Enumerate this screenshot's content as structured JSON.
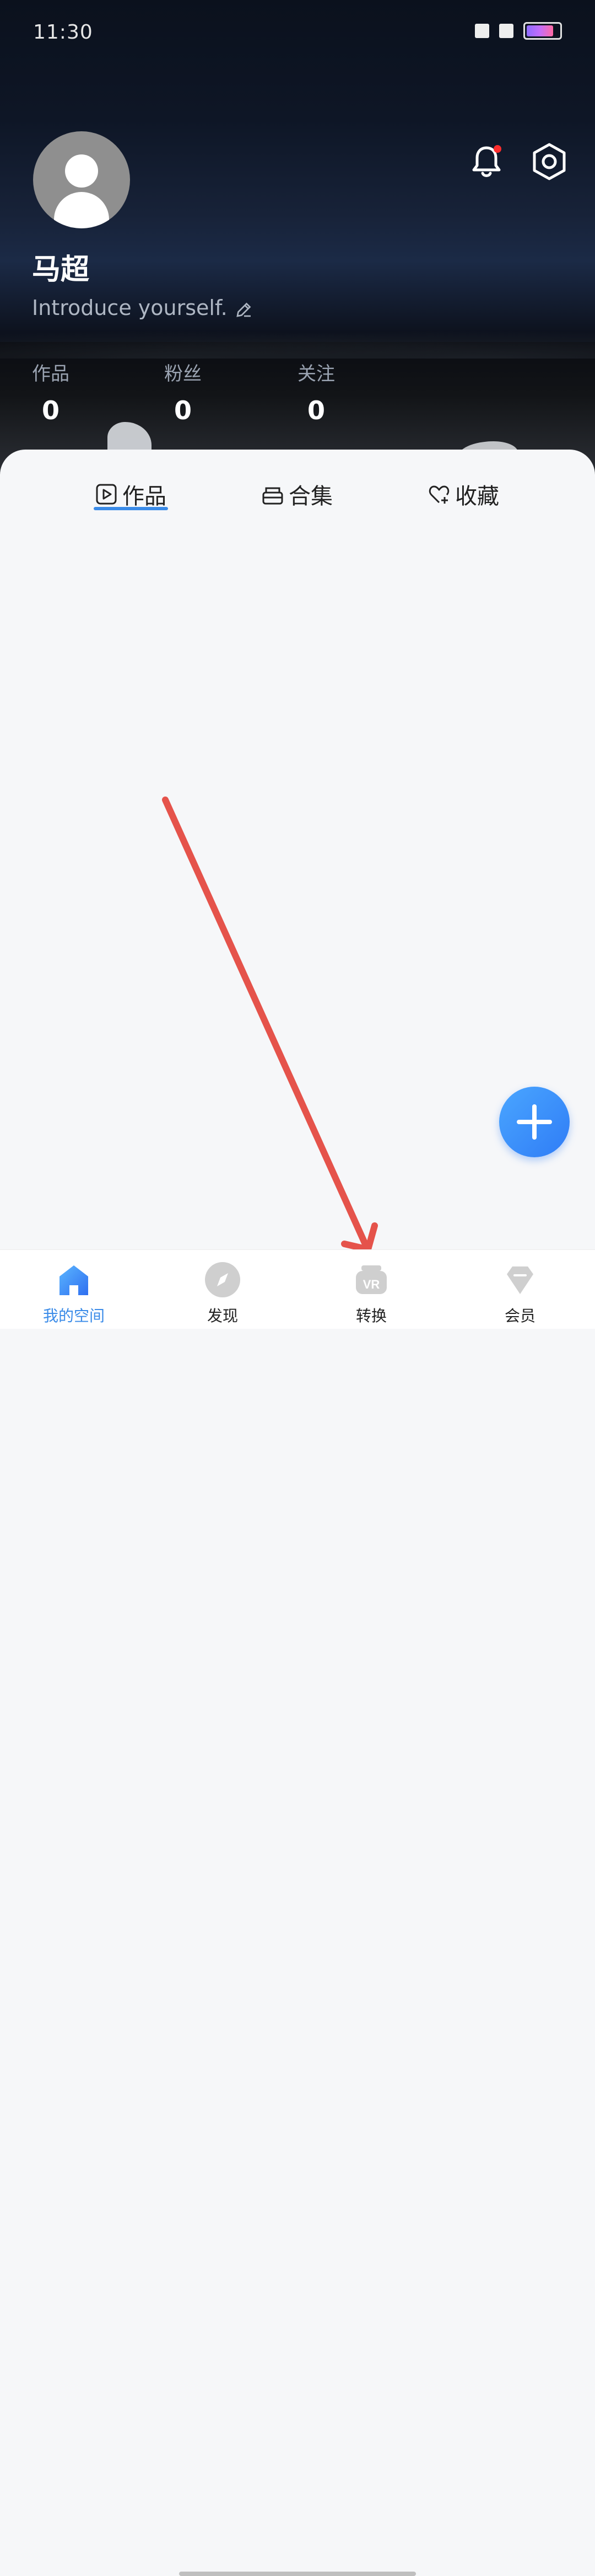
{
  "status_bar": {
    "time": "11:30"
  },
  "profile": {
    "name": "马超",
    "bio": "Introduce yourself.",
    "stats": [
      {
        "label": "作品",
        "value": "0"
      },
      {
        "label": "粉丝",
        "value": "0"
      },
      {
        "label": "关注",
        "value": "0"
      }
    ]
  },
  "tabs": [
    {
      "label": "作品",
      "active": true,
      "icon": "play-square-icon"
    },
    {
      "label": "合集",
      "active": false,
      "icon": "stack-icon"
    },
    {
      "label": "收藏",
      "active": false,
      "icon": "heart-plus-icon"
    }
  ],
  "bottom_nav": [
    {
      "label": "我的空间",
      "icon": "home-icon",
      "active": true
    },
    {
      "label": "发现",
      "icon": "compass-icon",
      "active": false
    },
    {
      "label": "转换",
      "icon": "vr-icon",
      "active": false
    },
    {
      "label": "会员",
      "icon": "diamond-icon",
      "active": false
    }
  ],
  "colors": {
    "accent": "#3a8be8",
    "fab": "#2f7cf6",
    "annotation": "#e5534b"
  }
}
